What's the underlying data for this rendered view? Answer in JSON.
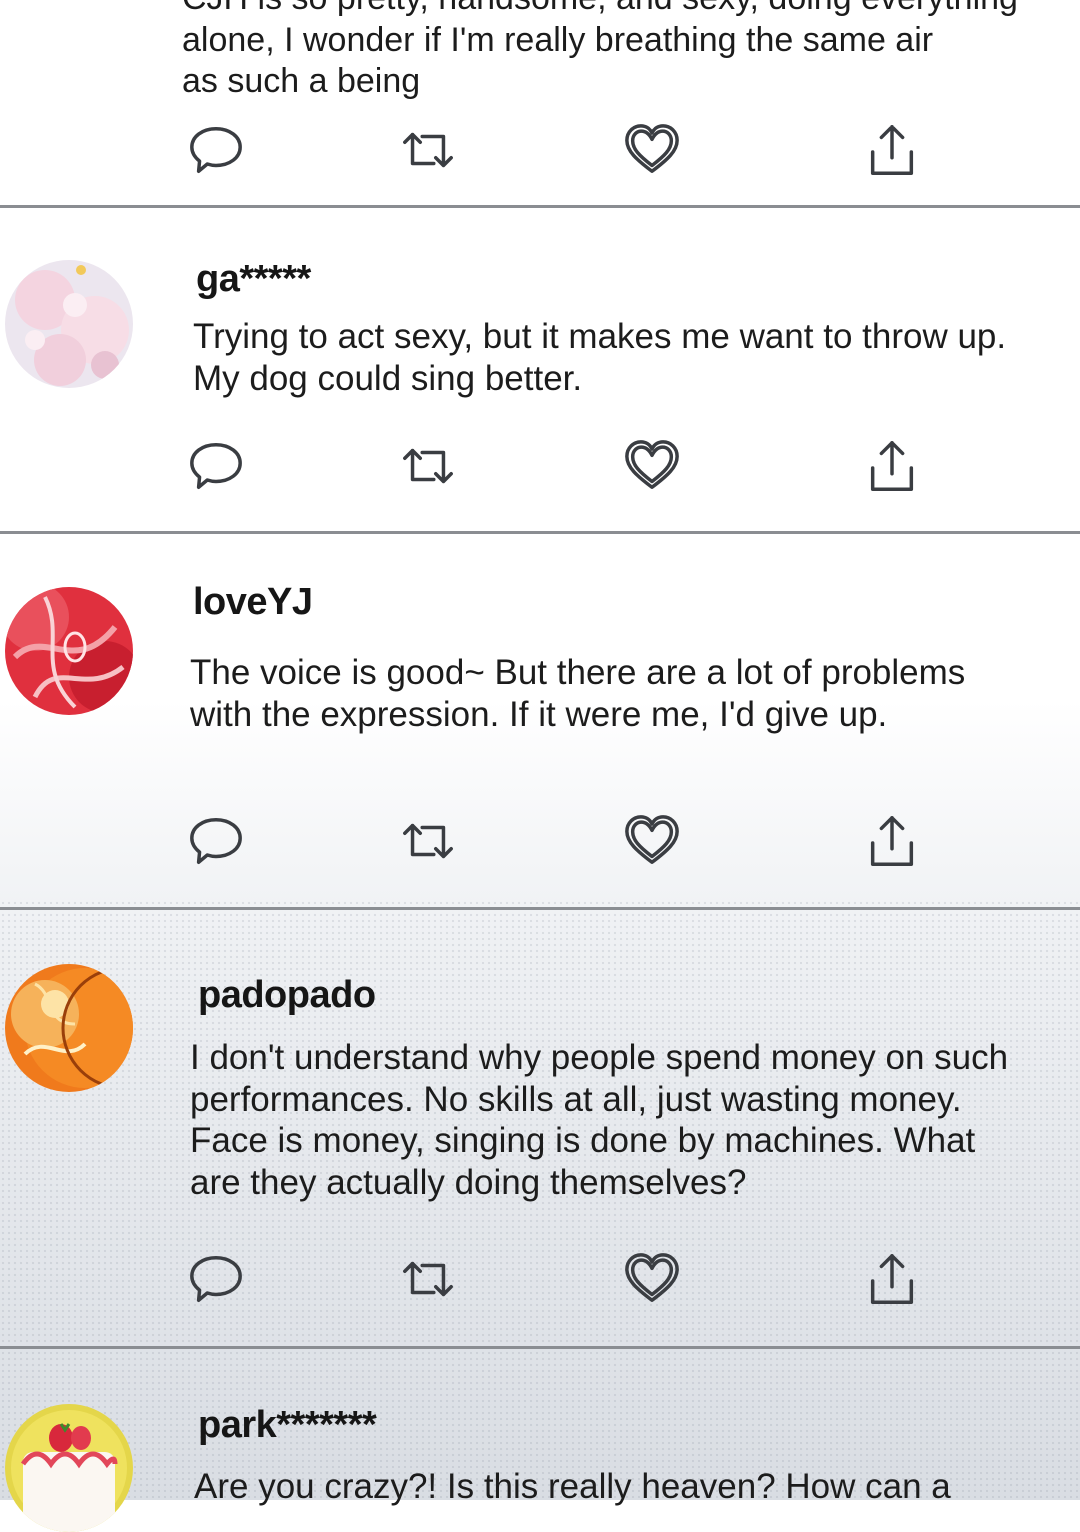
{
  "posts": [
    {
      "username": "",
      "lines": [
        "CJH is so pretty, handsome, and sexy, doing everything",
        "alone, I wonder if I'm really breathing the same air",
        "as such a being"
      ]
    },
    {
      "username": "ga*****",
      "lines": [
        "Trying to act sexy, but it makes me want to throw up.",
        "My dog could sing better."
      ]
    },
    {
      "username": "loveYJ",
      "lines": [
        "The voice is good~ But there are a lot of problems",
        "with the expression. If it were me, I'd give up."
      ]
    },
    {
      "username": "padopado",
      "lines": [
        "I don't understand why people spend money on such",
        "performances. No skills at all, just wasting money.",
        "Face is money, singing is done by machines. What",
        "are they actually doing themselves?"
      ]
    },
    {
      "username": "park*******",
      "lines": [
        "Are you crazy?! Is this really heaven? How can a"
      ]
    }
  ],
  "icons": {
    "reply": "speech-bubble-icon",
    "retweet": "retweet-icon",
    "like": "heart-icon",
    "share": "share-icon"
  },
  "colors": {
    "divider": "#8a8d92",
    "icon": "#3a3d42",
    "text": "#1c1c1c"
  }
}
